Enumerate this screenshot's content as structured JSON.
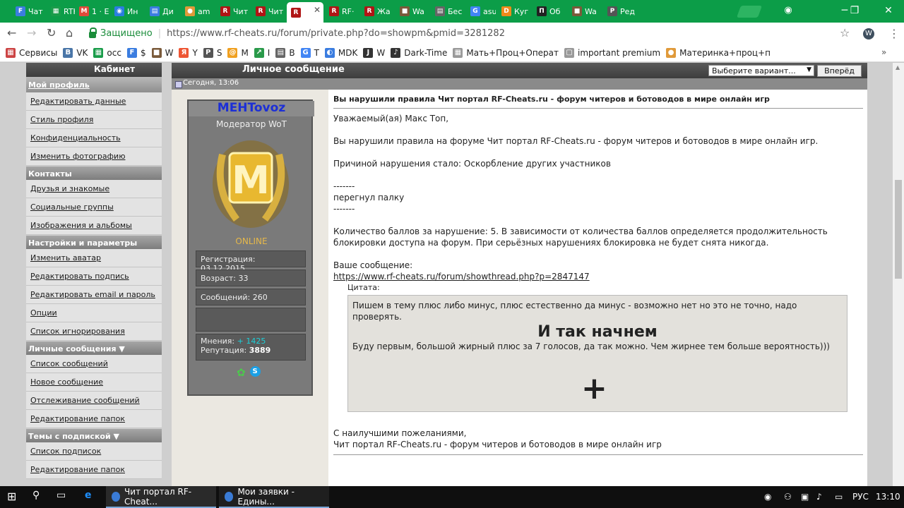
{
  "tabs": [
    {
      "label": "Чат",
      "icon": "F",
      "color": "#3b7de0"
    },
    {
      "label": "RTK",
      "icon": "▦",
      "color": "#1a9c4a"
    },
    {
      "label": "1 · E",
      "icon": "M",
      "color": "#e04a3a"
    },
    {
      "label": "Ин",
      "icon": "◉",
      "color": "#2a7de0"
    },
    {
      "label": "Ди",
      "icon": "▤",
      "color": "#3b7de0"
    },
    {
      "label": "am",
      "icon": "●",
      "color": "#e09a3a"
    },
    {
      "label": "Чит",
      "icon": "R",
      "color": "#b01515"
    },
    {
      "label": "Чит",
      "icon": "R",
      "color": "#b01515"
    },
    {
      "label": "",
      "icon": "R",
      "color": "#b01515"
    },
    {
      "label": "RF·",
      "icon": "R",
      "color": "#b01515"
    },
    {
      "label": "Жа",
      "icon": "R",
      "color": "#b01515"
    },
    {
      "label": "Wa",
      "icon": "■",
      "color": "#7a5a3a"
    },
    {
      "label": "Бес",
      "icon": "▤",
      "color": "#666"
    },
    {
      "label": "asu",
      "icon": "G",
      "color": "#4285f4"
    },
    {
      "label": "Куг",
      "icon": "D",
      "color": "#f08a1a"
    },
    {
      "label": "Об",
      "icon": "П",
      "color": "#222"
    },
    {
      "label": "Wa",
      "icon": "■",
      "color": "#7a5a3a"
    },
    {
      "label": "Ред",
      "icon": "P",
      "color": "#555"
    }
  ],
  "toolbar": {
    "secure": "Защищено",
    "url": "https://www.rf-cheats.ru/forum/private.php?do=showpm&pmid=3281282",
    "ext_icon": "W"
  },
  "bookmarks": [
    {
      "label": "Сервисы",
      "icon": "▦",
      "color": "#c44"
    },
    {
      "label": "VK",
      "icon": "В",
      "color": "#4a76a8"
    },
    {
      "label": "осс",
      "icon": "▦",
      "color": "#1a9c4a"
    },
    {
      "label": "$",
      "icon": "F",
      "color": "#3b7de0"
    },
    {
      "label": "W",
      "icon": "■",
      "color": "#7a5a3a"
    },
    {
      "label": "Y",
      "icon": "Я",
      "color": "#e53"
    },
    {
      "label": "S",
      "icon": "P",
      "color": "#555"
    },
    {
      "label": "M",
      "icon": "@",
      "color": "#f0a020"
    },
    {
      "label": "I",
      "icon": "↗",
      "color": "#2a9a4a"
    },
    {
      "label": "B",
      "icon": "▤",
      "color": "#666"
    },
    {
      "label": "T",
      "icon": "G",
      "color": "#4285f4"
    },
    {
      "label": "MDK",
      "icon": "◐",
      "color": "#3b7de0"
    },
    {
      "label": "W",
      "icon": "J",
      "color": "#333"
    },
    {
      "label": "Dark-Time",
      "icon": "♪",
      "color": "#333"
    },
    {
      "label": "Мать+Проц+Операт",
      "icon": "▦",
      "color": "#999"
    },
    {
      "label": "important premium",
      "icon": "▢",
      "color": "#999"
    },
    {
      "label": "Материнка+проц+п",
      "icon": "●",
      "color": "#e09a3a"
    }
  ],
  "sidebar": {
    "header": "Кабинет",
    "first": "Мой профиль",
    "profile_links": [
      "Редактировать данные",
      "Стиль профиля",
      "Конфиденциальность",
      "Изменить фотографию"
    ],
    "cat_contacts": "Контакты",
    "contact_links": [
      "Друзья и знакомые",
      "Социальные группы",
      "Изображения и альбомы"
    ],
    "cat_settings": "Настройки и параметры",
    "settings_links": [
      "Изменить аватар",
      "Редактировать подпись",
      "Редактировать email и пароль",
      "Опции",
      "Список игнорирования"
    ],
    "cat_pm": "Личные сообщения ▼",
    "pm_links": [
      "Список сообщений",
      "Новое сообщение",
      "Отслеживание сообщений",
      "Редактирование папок"
    ],
    "cat_subs": "Темы с подпиской ▼",
    "subs_links": [
      "Список подписок",
      "Редактирование папок"
    ]
  },
  "main": {
    "title": "Личное сообщение",
    "select": "Выберите вариант...",
    "go": "Вперёд",
    "date": "Сегодня, 13:06"
  },
  "user": {
    "name": "MEHTovoz",
    "title": "Модератор WoT",
    "rank_letter": "M",
    "status": "ONLINE",
    "registration": "Регистрация: 03.12.2015",
    "age": "Возраст: 33",
    "posts": "Сообщений: 260",
    "opinions_label": "Мнения:",
    "opinions_value": "+ 1425",
    "reputation_label": "Репутация:",
    "reputation_value": "3889"
  },
  "message": {
    "subject": "Вы нарушили правила Чит портал RF-Cheats.ru - форум читеров и ботоводов в мире онлайн игр",
    "greeting": "Уважаемый(ая) Макс Топ,",
    "line1": "Вы нарушили правила на форуме Чит портал RF-Cheats.ru - форум читеров и ботоводов в мире онлайн игр.",
    "reason": "Причиной нарушения стало: Оскорбление других участников",
    "dash": "-------",
    "note": "перегнул палку",
    "points": "Количество баллов за нарушение: 5. В зависимости от количества баллов определяется продолжительность блокировки доступа на форум. При серьёзных нарушениях блокировка не будет снята никогда.",
    "your_msg": "Ваше сообщение:",
    "link": "https://www.rf-cheats.ru/forum/showthread.php?p=2847147",
    "quote_label": "Цитата:",
    "quote1": "Пишем в тему плюс либо минус, плюс естественно да минус - возможно нет но это не точно, надо проверять.",
    "quote_big": "И так начнем",
    "quote2": "Буду первым, большой жирный плюс за 7 голосов, да так можно. Чем жирнее тем больше вероятность)))",
    "quote_plus": "+",
    "closing1": "С наилучшими пожеланиями,",
    "closing2": "Чит портал RF-Cheats.ru - форум читеров и ботоводов в мире онлайн игр"
  },
  "taskbar": {
    "task1": "Чит портал RF-Cheat...",
    "task2": "Мои заявки - Едины...",
    "lang": "РУС",
    "time": "13:10"
  }
}
